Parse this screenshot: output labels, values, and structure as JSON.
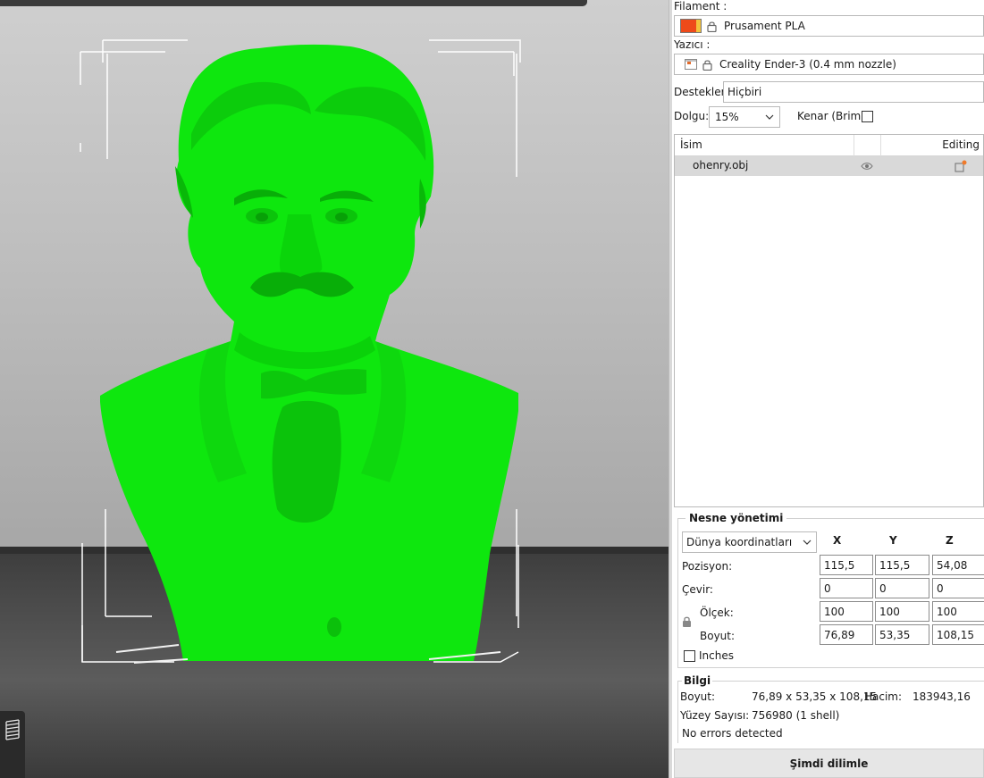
{
  "viewport": {
    "model_color": "#00e600",
    "bed_color": "#3c3c3c",
    "background_color": "#c4c4c4",
    "layer_view_icon": "layers-icon"
  },
  "panel": {
    "filament": {
      "label": "Filament :",
      "value": "Prusament PLA",
      "swatch_colors": [
        "#ee4a1a",
        "#f3c23c"
      ],
      "icon": "lock-icon"
    },
    "printer": {
      "label": "Yazıcı :",
      "value": "Creality Ender-3 (0.4 mm nozzle)",
      "icons": [
        "printer-icon",
        "lock-icon"
      ]
    },
    "supports": {
      "label": "Destekler:",
      "value": "Hiçbiri"
    },
    "infill": {
      "label": "Dolgu:",
      "value": "15%"
    },
    "brim": {
      "label": "Kenar (Brim):",
      "checked": false
    },
    "object_list": {
      "col_name": "İsim",
      "col_editing": "Editing",
      "rows": [
        {
          "name": "ohenry.obj",
          "visible_icon": "eye-icon",
          "edit_icon": "edit-settings-icon"
        }
      ]
    },
    "object_manipulation": {
      "title": "Nesne yönetimi",
      "coordinate_system": "Dünya koordinatları",
      "axes": [
        "X",
        "Y",
        "Z"
      ],
      "position": {
        "label": "Pozisyon:",
        "values": [
          "115,5",
          "115,5",
          "54,08"
        ]
      },
      "rotation": {
        "label": "Çevir:",
        "values": [
          "0",
          "0",
          "0"
        ]
      },
      "scale": {
        "label": "Ölçek:",
        "values": [
          "100",
          "100",
          "100"
        ]
      },
      "size": {
        "label": "Boyut:",
        "values": [
          "76,89",
          "53,35",
          "108,15"
        ]
      },
      "inches": {
        "label": "Inches",
        "checked": false
      }
    },
    "info": {
      "title": "Bilgi",
      "size_label": "Boyut:",
      "size_value": "76,89 x 53,35 x 108,15",
      "volume_label": "Hacim:",
      "volume_value": "183943,16",
      "facets_label": "Yüzey Sayısı:",
      "facets_value": "756980 (1 shell)",
      "errors": "No errors detected"
    },
    "slice_button": "Şimdi dilimle"
  }
}
